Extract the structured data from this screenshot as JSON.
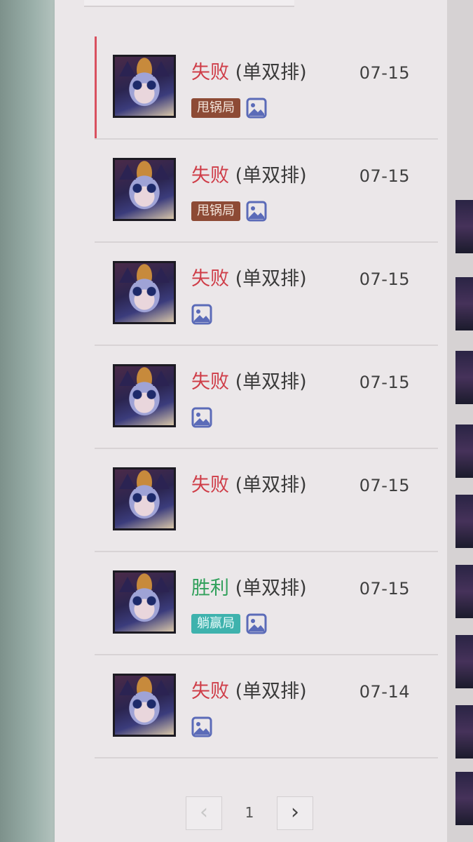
{
  "matches": [
    {
      "outcome": "失败",
      "result_type": "loss",
      "queue": "(单双排)",
      "date": "07-15",
      "badge": "甩锅局",
      "badge_color": "#8d4a35",
      "selected": true
    },
    {
      "outcome": "失败",
      "result_type": "loss",
      "queue": "(单双排)",
      "date": "07-15",
      "badge": "甩锅局",
      "badge_color": "#8d4a35",
      "selected": false
    },
    {
      "outcome": "失败",
      "result_type": "loss",
      "queue": "(单双排)",
      "date": "07-15",
      "badge": "",
      "selected": false
    },
    {
      "outcome": "失败",
      "result_type": "loss",
      "queue": "(单双排)",
      "date": "07-15",
      "badge": "",
      "selected": false
    },
    {
      "outcome": "失败",
      "result_type": "loss",
      "queue": "(单双排)",
      "date": "07-15",
      "badge": "",
      "selected": false,
      "no_image_icon": true
    },
    {
      "outcome": "胜利",
      "result_type": "win",
      "queue": "(单双排)",
      "date": "07-15",
      "badge": "躺赢局",
      "badge_color": "#3eb2ad",
      "selected": false
    },
    {
      "outcome": "失败",
      "result_type": "loss",
      "queue": "(单双排)",
      "date": "07-14",
      "badge": "",
      "selected": false
    }
  ],
  "pagination": {
    "prev_icon": "chevron-left-icon",
    "current_page": "1",
    "next_icon": "chevron-right-icon"
  },
  "colors": {
    "loss": "#cf3d48",
    "win": "#31a05b",
    "selected_marker": "#d9505f",
    "image_icon": "#5b6bb8"
  }
}
